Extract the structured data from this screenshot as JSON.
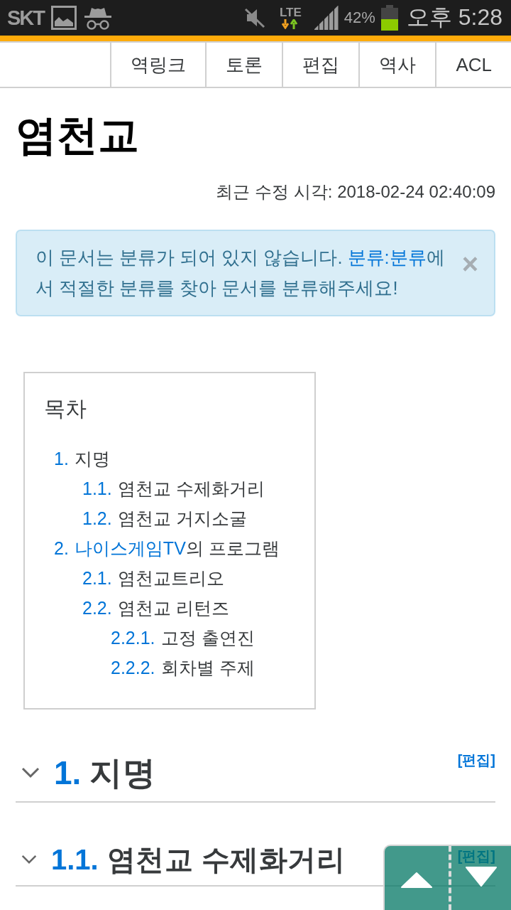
{
  "status_bar": {
    "carrier": "SKT",
    "network": "LTE",
    "battery": "42%",
    "time": "오후 5:28"
  },
  "page_actions": [
    {
      "label": "역링크"
    },
    {
      "label": "토론"
    },
    {
      "label": "편집"
    },
    {
      "label": "역사"
    },
    {
      "label": "ACL"
    }
  ],
  "title": "염천교",
  "last_modified": "최근 수정 시각: 2018-02-24 02:40:09",
  "alert": {
    "parts": [
      {
        "kind": "text",
        "text": "이 문서는 분류가 되어 있지 않습니다. "
      },
      {
        "kind": "link",
        "text": "분류:분류"
      },
      {
        "kind": "text",
        "text": "에서 적절한 분류를 찾아 문서를 분류해주세요!"
      }
    ],
    "close": "×"
  },
  "toc": {
    "title": "목차",
    "items": [
      {
        "number": "1.",
        "parts": [
          {
            "kind": "text",
            "text": "지명"
          }
        ],
        "children": [
          {
            "number": "1.1.",
            "parts": [
              {
                "kind": "text",
                "text": "염천교 수제화거리"
              }
            ]
          },
          {
            "number": "1.2.",
            "parts": [
              {
                "kind": "text",
                "text": "염천교 거지소굴"
              }
            ]
          }
        ]
      },
      {
        "number": "2.",
        "parts": [
          {
            "kind": "link",
            "text": "나이스게임TV"
          },
          {
            "kind": "text",
            "text": "의 프로그램"
          }
        ],
        "children": [
          {
            "number": "2.1.",
            "parts": [
              {
                "kind": "text",
                "text": "염천교트리오"
              }
            ]
          },
          {
            "number": "2.2.",
            "parts": [
              {
                "kind": "text",
                "text": "염천교 리턴즈"
              }
            ],
            "children": [
              {
                "number": "2.2.1.",
                "parts": [
                  {
                    "kind": "text",
                    "text": "고정 출연진"
                  }
                ]
              },
              {
                "number": "2.2.2.",
                "parts": [
                  {
                    "kind": "text",
                    "text": "회차별 주제"
                  }
                ]
              }
            ]
          }
        ]
      }
    ]
  },
  "sections": [
    {
      "number": "1.",
      "title": "지명",
      "edit": "[편집]",
      "expanded": true,
      "children": [
        {
          "number": "1.1.",
          "title": "염천교 수제화거리",
          "edit": "[편집]",
          "expanded": true
        }
      ]
    }
  ]
}
